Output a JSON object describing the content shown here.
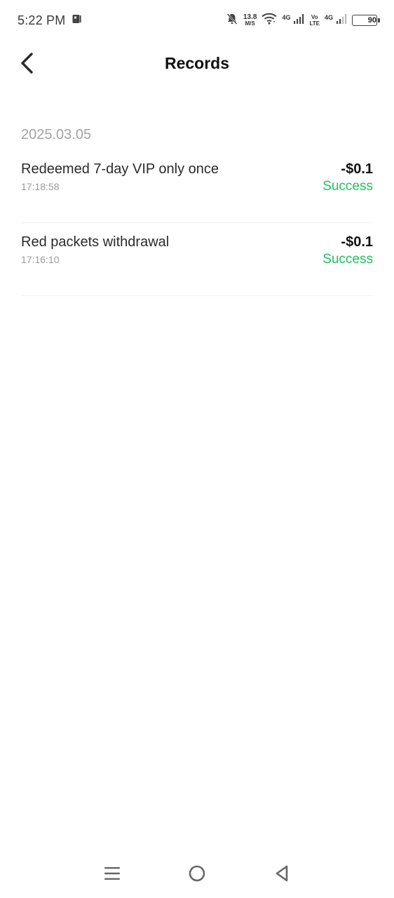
{
  "status_bar": {
    "time": "5:22 PM",
    "net_speed": "13.8",
    "net_speed_unit": "M/S",
    "signal1_label": "4G",
    "volte_top": "Vo",
    "volte_bottom": "LTE",
    "signal2_label": "4G",
    "battery": "90",
    "battery_level": 0.9,
    "icons": [
      "app-notification-icon",
      "bell-muted-icon",
      "wifi-icon",
      "signal-icon",
      "battery-icon"
    ]
  },
  "header": {
    "title": "Records",
    "back_icon": "chevron-left-icon"
  },
  "records": {
    "date": "2025.03.05",
    "items": [
      {
        "title": "Redeemed 7-day VIP only once",
        "time": "17:18:58",
        "amount": "-$0.1",
        "status": "Success"
      },
      {
        "title": "Red packets withdrawal",
        "time": "17:16:10",
        "amount": "-$0.1",
        "status": "Success"
      }
    ]
  },
  "nav_bar": {
    "icons": [
      "menu-icon",
      "home-circle-icon",
      "back-triangle-icon"
    ]
  },
  "colors": {
    "success": "#22c05e",
    "date_gray": "#a3a3a3",
    "divider": "#efefef"
  }
}
